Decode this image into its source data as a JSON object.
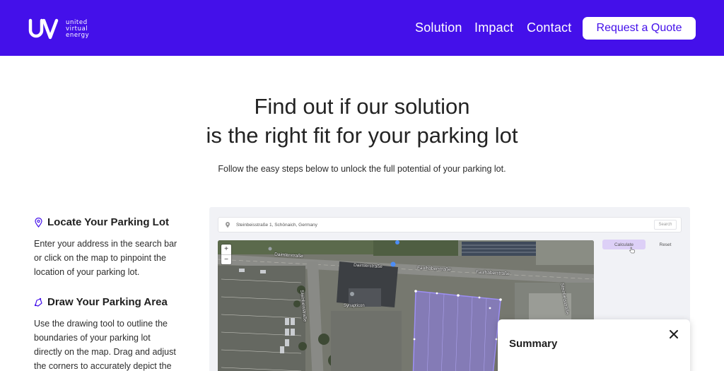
{
  "brand": {
    "logo_lines": [
      "united",
      "virtual",
      "energy"
    ],
    "color": "#4410ea"
  },
  "nav": {
    "items": [
      "Solution",
      "Impact",
      "Contact"
    ],
    "cta": "Request a Quote"
  },
  "hero": {
    "title_line1": "Find out if our solution",
    "title_line2": "is the right fit for your parking lot",
    "subtitle": "Follow the easy steps below to unlock the full potential of your parking lot."
  },
  "steps": [
    {
      "icon": "location-pin-icon",
      "title": "Locate Your Parking Lot",
      "body": "Enter your address in the search bar or click on the map to pinpoint the location of your parking lot."
    },
    {
      "icon": "draw-polygon-icon",
      "title": "Draw Your Parking Area",
      "body": "Use the drawing tool to outline the boundaries of your parking lot directly on the map. Drag and adjust the corners to accurately depict the"
    }
  ],
  "app": {
    "search_value": "Steinbeisstraße 1, Schönaich, Germany",
    "search_button": "Search",
    "calculate_button": "Calculate",
    "reset_button": "Reset",
    "zoom_in": "+",
    "zoom_out": "−",
    "map_labels": [
      "Daimlerstraße",
      "Daimlerstraße",
      "Faulhaberstraße",
      "Faulhaberstraße",
      "Steinbeisstraße",
      "Steinbeisstraße",
      "Synapticon"
    ],
    "polygon_color": "#8f7df0"
  },
  "summary": {
    "title": "Summary",
    "close_icon": "close-icon"
  }
}
